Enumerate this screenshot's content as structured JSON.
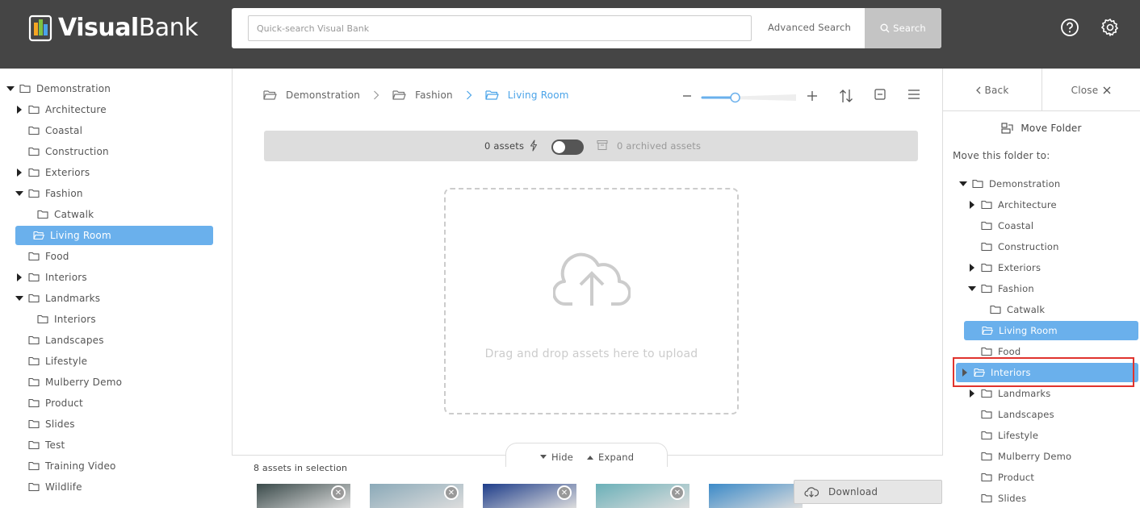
{
  "header": {
    "logo_word_1": "Visual",
    "logo_word_2": "Bank",
    "search_placeholder": "Quick-search Visual Bank",
    "advanced_search_label": "Advanced Search",
    "search_button_label": "Search",
    "help_icon": "help-circle-icon",
    "settings_icon": "gear-icon"
  },
  "left_tree": {
    "items": [
      {
        "label": "Demonstration",
        "expander": "down"
      },
      {
        "label": "Architecture",
        "expander": "right"
      },
      {
        "label": "Coastal",
        "expander": "none"
      },
      {
        "label": "Construction",
        "expander": "none"
      },
      {
        "label": "Exteriors",
        "expander": "right"
      },
      {
        "label": "Fashion",
        "expander": "down"
      },
      {
        "label": "Catwalk",
        "expander": "none"
      },
      {
        "label": "Living Room",
        "expander": "none",
        "selected": true
      },
      {
        "label": "Food",
        "expander": "none"
      },
      {
        "label": "Interiors",
        "expander": "right"
      },
      {
        "label": "Landmarks",
        "expander": "down"
      },
      {
        "label": "Interiors",
        "expander": "none"
      },
      {
        "label": "Landscapes",
        "expander": "none"
      },
      {
        "label": "Lifestyle",
        "expander": "none"
      },
      {
        "label": "Mulberry Demo",
        "expander": "none"
      },
      {
        "label": "Product",
        "expander": "none"
      },
      {
        "label": "Slides",
        "expander": "none"
      },
      {
        "label": "Test",
        "expander": "none"
      },
      {
        "label": "Training Video",
        "expander": "none"
      },
      {
        "label": "Wildlife",
        "expander": "none"
      }
    ]
  },
  "main": {
    "breadcrumb": [
      "Demonstration",
      "Fashion",
      "Living Room"
    ],
    "zoom_level": 0.35,
    "asset_count": "0 assets",
    "archived_count": "0 archived assets",
    "dropzone_text": "Drag and drop assets here to upload"
  },
  "tray": {
    "hide_label": "Hide",
    "expand_label": "Expand",
    "selection_count": "8 assets in selection",
    "download_label": "Download",
    "thumb_colors": [
      "#3a4a4a",
      "#8aa9b8",
      "#1e3d8a",
      "#6ab0b8",
      "#3c8ac8"
    ]
  },
  "right_panel": {
    "back_label": "Back",
    "close_label": "Close",
    "title": "Move Folder",
    "subtitle": "Move this folder to:",
    "items": [
      {
        "label": "Demonstration",
        "expander": "down"
      },
      {
        "label": "Architecture",
        "expander": "right"
      },
      {
        "label": "Coastal",
        "expander": "none"
      },
      {
        "label": "Construction",
        "expander": "none"
      },
      {
        "label": "Exteriors",
        "expander": "right"
      },
      {
        "label": "Fashion",
        "expander": "down"
      },
      {
        "label": "Catwalk",
        "expander": "none"
      },
      {
        "label": "Living Room",
        "expander": "none",
        "selected": true
      },
      {
        "label": "Food",
        "expander": "none"
      },
      {
        "label": "Interiors",
        "expander": "right",
        "selected": true
      },
      {
        "label": "Landmarks",
        "expander": "right"
      },
      {
        "label": "Landscapes",
        "expander": "none"
      },
      {
        "label": "Lifestyle",
        "expander": "none"
      },
      {
        "label": "Mulberry Demo",
        "expander": "none"
      },
      {
        "label": "Product",
        "expander": "none"
      },
      {
        "label": "Slides",
        "expander": "none"
      }
    ]
  },
  "colors": {
    "header_bg": "#454545",
    "selected_bg": "#6ab0ec",
    "accent": "#4aa3e8",
    "highlight_border": "#e0332d"
  }
}
